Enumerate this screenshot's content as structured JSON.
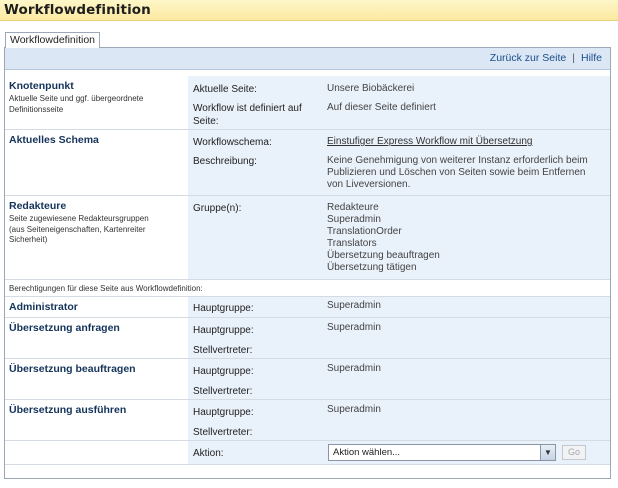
{
  "page": {
    "title": "Workflowdefinition"
  },
  "tab": {
    "label": "Workflowdefinition"
  },
  "toolbar": {
    "back_label": "Zurück zur Seite",
    "separator": "|",
    "help_label": "Hilfe"
  },
  "knotenpunkt": {
    "title": "Knotenpunkt",
    "subtitle": "Aktuelle Seite und ggf. übergeordnete Definitionsseite",
    "current_page_label": "Aktuelle Seite:",
    "current_page_value": "Unsere Biobäckerei",
    "defined_label": "Workflow ist definiert auf Seite:",
    "defined_value": "Auf dieser Seite definiert"
  },
  "schema": {
    "title": "Aktuelles Schema",
    "workflow_label": "Workflowschema:",
    "workflow_value": "Einstufiger Express Workflow mit Übersetzung",
    "description_label": "Beschreibung:",
    "description_value": "Keine Genehmigung von weiterer Instanz erforderlich beim Publizieren und Löschen von Seiten sowie beim Entfernen von Liveversionen."
  },
  "redakteure": {
    "title": "Redakteure",
    "subtitle": "Seite zugewiesene Redakteursgruppen (aus Seiteneigenschaften, Kartenreiter Sicherheit)",
    "groups_label": "Gruppe(n):",
    "groups": [
      "Redakteure",
      "Superadmin",
      "TranslationOrder",
      "Translators",
      "Übersetzung beauftragen",
      "Übersetzung tätigen"
    ]
  },
  "permissions_info": "Berechtigungen für diese Seite aus Workflowdefinition:",
  "roles": [
    {
      "title": "Administrator",
      "main_label": "Hauptgruppe:",
      "main_value": "Superadmin"
    },
    {
      "title": "Übersetzung anfragen",
      "main_label": "Hauptgruppe:",
      "main_value": "Superadmin",
      "deputy_label": "Stellvertreter:"
    },
    {
      "title": "Übersetzung beauftragen",
      "main_label": "Hauptgruppe:",
      "main_value": "Superadmin",
      "deputy_label": "Stellvertreter:"
    },
    {
      "title": "Übersetzung ausführen",
      "main_label": "Hauptgruppe:",
      "main_value": "Superadmin",
      "deputy_label": "Stellvertreter:"
    }
  ],
  "action": {
    "label": "Aktion:",
    "select_value": "Aktion wählen...",
    "go_label": "Go"
  }
}
